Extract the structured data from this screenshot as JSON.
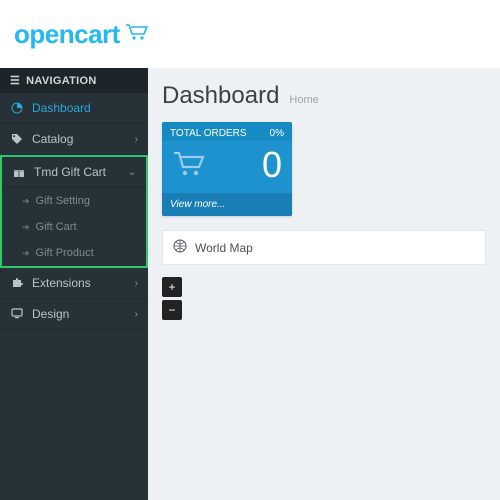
{
  "logo": "opencart",
  "nav_header": "NAVIGATION",
  "sidebar": {
    "items": [
      {
        "label": "Dashboard",
        "icon": "dashboard",
        "active": true
      },
      {
        "label": "Catalog",
        "icon": "tag",
        "caret": true
      },
      {
        "label": "Tmd Gift Cart",
        "icon": "gift",
        "caret": true,
        "open": true,
        "children": [
          {
            "label": "Gift Setting"
          },
          {
            "label": "Gift Cart"
          },
          {
            "label": "Gift Product"
          }
        ]
      },
      {
        "label": "Extensions",
        "icon": "puzzle",
        "caret": true
      },
      {
        "label": "Design",
        "icon": "desktop",
        "caret": true
      }
    ]
  },
  "page": {
    "title": "Dashboard",
    "breadcrumb": "Home"
  },
  "tile": {
    "title": "TOTAL ORDERS",
    "percent": "0%",
    "value": "0",
    "footer": "View more..."
  },
  "worldmap": {
    "label": "World Map"
  },
  "zoom": {
    "in": "+",
    "out": "−"
  }
}
